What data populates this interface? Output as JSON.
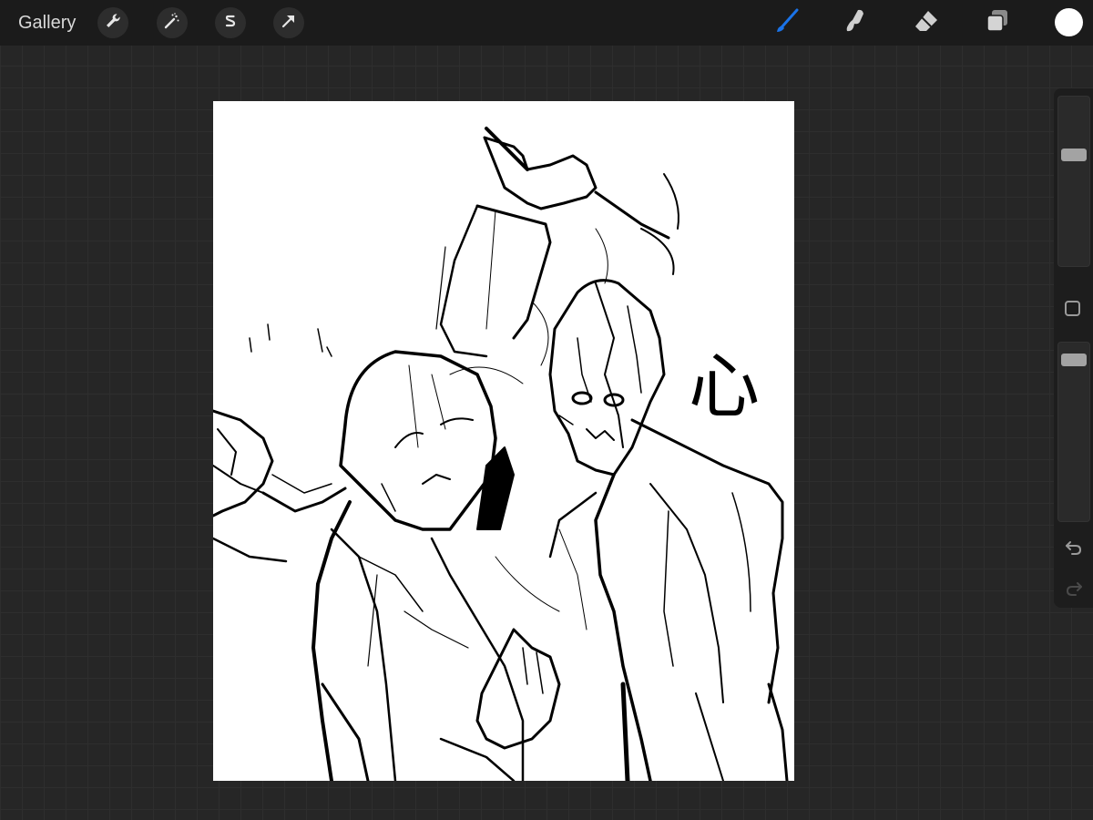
{
  "topbar": {
    "gallery_label": "Gallery",
    "left_tools": [
      "wrench-icon",
      "magic-wand-icon",
      "selection-s-icon",
      "transform-arrow-icon"
    ],
    "right_tools": [
      "brush-icon",
      "smudge-icon",
      "eraser-icon",
      "layers-icon"
    ],
    "active_tool": "brush",
    "active_color": "#ffffff"
  },
  "colors": {
    "accent": "#1a73e8",
    "toolbar_bg": "#1b1b1b",
    "canvas_bg": "#ffffff",
    "workspace_bg": "#262626"
  },
  "sidebar": {
    "brush_size": 0.74,
    "opacity": 0.98,
    "controls": [
      "brush-size-slider",
      "modify-button",
      "opacity-slider",
      "undo-icon",
      "redo-icon"
    ]
  },
  "canvas": {
    "glyph": "心"
  }
}
